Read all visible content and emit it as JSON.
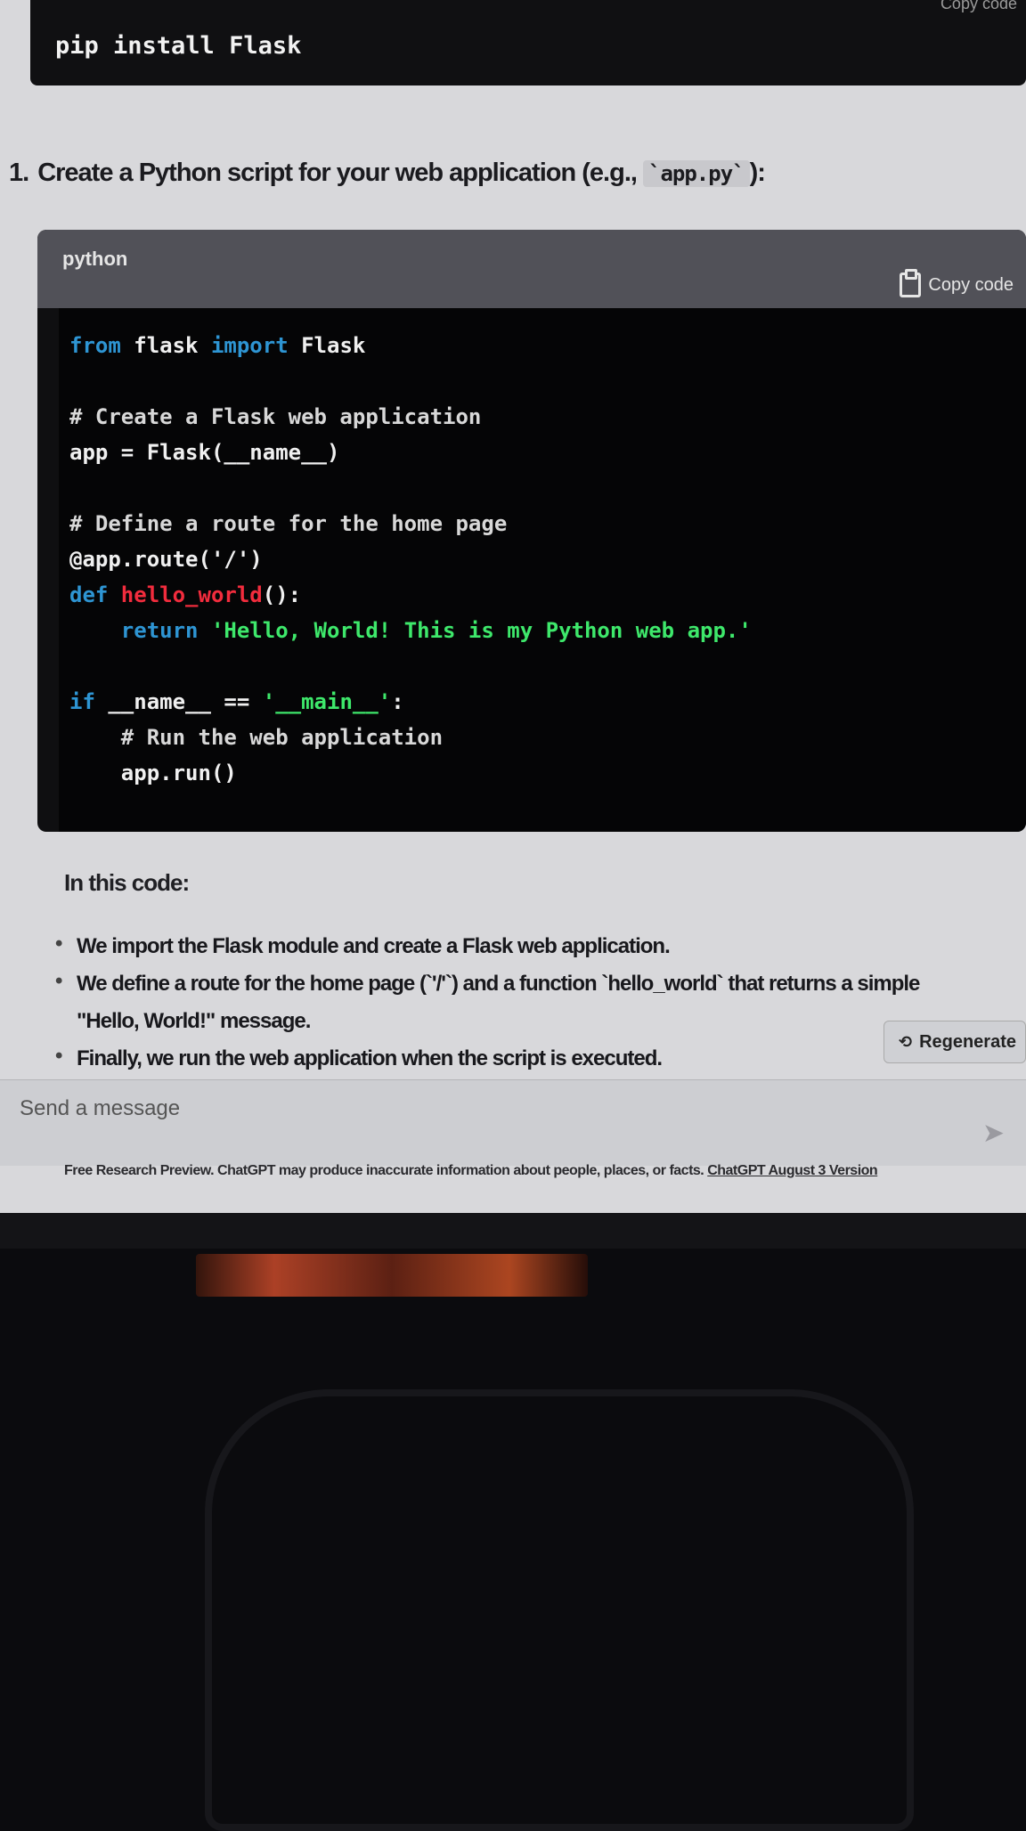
{
  "top_code": {
    "line": "pip install Flask",
    "copy_label": "Copy code"
  },
  "step": {
    "number": "1.",
    "text": "Create a Python script for your web application (e.g., ",
    "code": "`app.py`",
    "suffix": "):"
  },
  "codeblock": {
    "language": "python",
    "copy_label": "Copy code",
    "lines": {
      "l1_kw1": "from",
      "l1_mod": " flask ",
      "l1_kw2": "import",
      "l1_name": " Flask",
      "l3": "# Create a Flask web application",
      "l4": "app = Flask(__name__)",
      "l6": "# Define a route for the home page",
      "l7": "@app.route('/')",
      "l8_kw": "def",
      "l8_fn": " hello_world",
      "l8_rest": "():",
      "l9_kw": "    return",
      "l9_str": " 'Hello, World! This is my Python web app.'",
      "l11_kw": "if",
      "l11_rest": " __name__ == ",
      "l11_str": "'__main__'",
      "l11_end": ":",
      "l12": "    # Run the web application",
      "l13": "    app.run()"
    }
  },
  "explanation": {
    "title": "In this code:",
    "bullets": [
      "We import the Flask module and create a Flask web application.",
      "We define a route for the home page (`'/'`) and a function `hello_world` that returns a simple \"Hello, World!\" message.",
      "Finally, we run the web application when the script is executed."
    ]
  },
  "regenerate": {
    "label": "Regenerate"
  },
  "input": {
    "placeholder": "Send a message"
  },
  "footer": {
    "text": "Free Research Preview. ChatGPT may produce inaccurate information about people, places, or facts. ",
    "link": "ChatGPT August 3 Version"
  }
}
